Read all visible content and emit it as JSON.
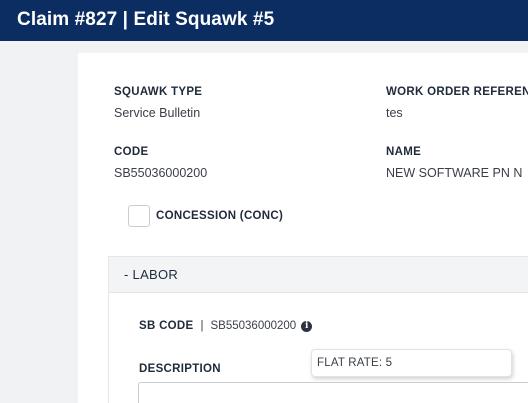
{
  "header": {
    "title": "Claim #827 | Edit Squawk #5"
  },
  "details": {
    "squawk_type_label": "SQUAWK TYPE",
    "squawk_type_value": "Service Bulletin",
    "work_order_label": "WORK ORDER REFEREN",
    "work_order_value": "tes",
    "code_label": "CODE",
    "code_value": "SB55036000200",
    "name_label": "NAME",
    "name_value": "NEW SOFTWARE PN N"
  },
  "concession": {
    "label": "CONCESSION (CONC)",
    "checked": false
  },
  "labor": {
    "header": "- LABOR",
    "sb_code_label": "SB CODE",
    "separator": "|",
    "sb_code_value": "SB55036000200",
    "info_icon": "info-icon",
    "tooltip_text": "FLAT RATE: 5",
    "description_label": "DESCRIPTION"
  },
  "colors": {
    "topbar": "#0b2d61",
    "background": "#f1f2f4",
    "card": "#ffffff"
  }
}
